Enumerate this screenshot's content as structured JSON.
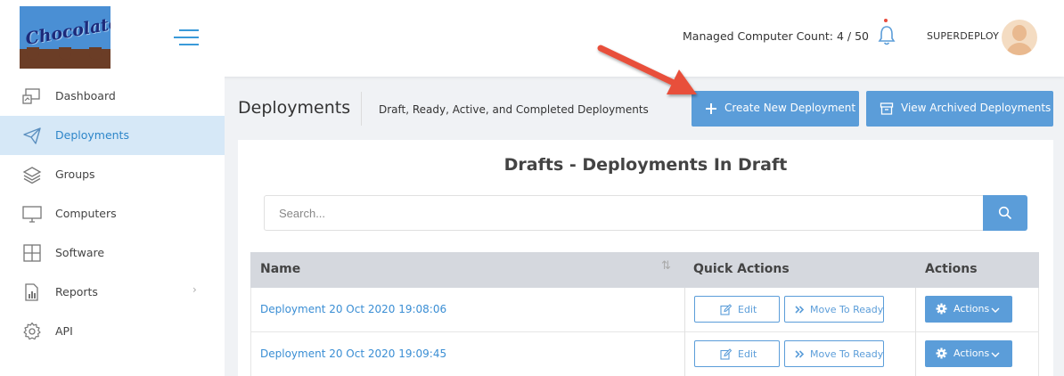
{
  "header": {
    "logo_text": "Chocolatey",
    "managed_count_label": "Managed Computer Count: 4 / 50",
    "username": "SUPERDEPLOY"
  },
  "sidebar": {
    "items": [
      {
        "label": "Dashboard",
        "icon": "dashboard-icon",
        "active": false
      },
      {
        "label": "Deployments",
        "icon": "paper-plane-icon",
        "active": true
      },
      {
        "label": "Groups",
        "icon": "layers-icon",
        "active": false
      },
      {
        "label": "Computers",
        "icon": "monitor-icon",
        "active": false
      },
      {
        "label": "Software",
        "icon": "grid-icon",
        "active": false
      },
      {
        "label": "Reports",
        "icon": "bar-chart-icon",
        "active": false,
        "has_submenu": true,
        "submenu_indicator": "›"
      },
      {
        "label": "API",
        "icon": "gear-icon",
        "active": false
      }
    ]
  },
  "page": {
    "title": "Deployments",
    "subtitle": "Draft, Ready, Active, and Completed Deployments",
    "create_button": "Create New Deployment",
    "archive_button": "View Archived Deployments"
  },
  "panel": {
    "title": "Drafts - Deployments In Draft",
    "search_placeholder": "Search...",
    "table": {
      "headers": [
        "Name",
        "Quick Actions",
        "Actions"
      ],
      "sort_indicator": "⇅",
      "rows": [
        {
          "name": "Deployment 20 Oct 2020 19:08:06",
          "edit": "Edit",
          "move": "Move To Ready",
          "actions": "Actions"
        },
        {
          "name": "Deployment 20 Oct 2020 19:09:45",
          "edit": "Edit",
          "move": "Move To Ready",
          "actions": "Actions"
        }
      ]
    }
  },
  "colors": {
    "accent": "#5b9dd9",
    "link": "#3a8ed4",
    "active_nav_bg": "#d6e8f7",
    "table_header_bg": "#d5d8de",
    "annotation_arrow": "#e8503a"
  }
}
